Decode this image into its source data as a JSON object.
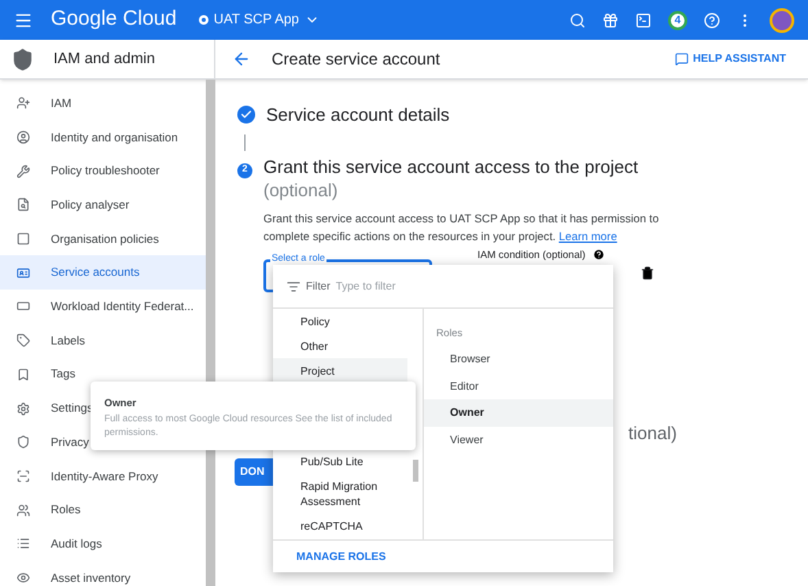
{
  "top_bar": {
    "product": "Google Cloud",
    "project": "UAT SCP App",
    "notification_count": "4"
  },
  "sidebar": {
    "title": "IAM and admin",
    "items": [
      {
        "label": "IAM",
        "selected": false
      },
      {
        "label": "Identity and organisation",
        "selected": false
      },
      {
        "label": "Policy troubleshooter",
        "selected": false
      },
      {
        "label": "Policy analyser",
        "selected": false
      },
      {
        "label": "Organisation policies",
        "selected": false
      },
      {
        "label": "Service accounts",
        "selected": true
      },
      {
        "label": "Workload Identity Federat...",
        "selected": false
      },
      {
        "label": "Labels",
        "selected": false
      },
      {
        "label": "Tags",
        "selected": false
      },
      {
        "label": "Settings",
        "selected": false
      },
      {
        "label": "Privacy",
        "selected": false
      },
      {
        "label": "Identity-Aware Proxy",
        "selected": false
      },
      {
        "label": "Roles",
        "selected": false
      },
      {
        "label": "Audit logs",
        "selected": false
      },
      {
        "label": "Asset inventory",
        "selected": false
      }
    ]
  },
  "header": {
    "title": "Create service account",
    "help": "HELP ASSISTANT"
  },
  "step_done": {
    "title": "Service account details"
  },
  "step_active": {
    "number": "2",
    "title": "Grant this service account access to the project",
    "optional": "(optional)",
    "description": "Grant this service account access to UAT SCP App so that it has permission to complete specific actions on the resources in your project.",
    "link": "Learn more"
  },
  "role_field": {
    "label": "Select a role"
  },
  "condition_label": "IAM condition (optional)",
  "done_button": "DON",
  "step3_fragment": "tional)",
  "role_menu": {
    "filter_label": "Filter",
    "filter_placeholder": "Type to filter",
    "categories": [
      {
        "label": "Policy",
        "selected": false
      },
      {
        "label": "Other",
        "selected": false
      },
      {
        "label": "Project",
        "selected": true
      },
      {
        "label": "Pub/Sub Lite",
        "selected": false
      },
      {
        "label": "Rapid Migration Assessment",
        "selected": false
      },
      {
        "label": "reCAPTCHA",
        "selected": false
      }
    ],
    "roles_heading": "Roles",
    "roles": [
      {
        "label": "Browser",
        "selected": false
      },
      {
        "label": "Editor",
        "selected": false
      },
      {
        "label": "Owner",
        "selected": true
      },
      {
        "label": "Viewer",
        "selected": false
      }
    ],
    "footer": "MANAGE ROLES"
  },
  "tooltip": {
    "title": "Owner",
    "text": "Full access to most Google Cloud resources See the list of included permissions."
  }
}
